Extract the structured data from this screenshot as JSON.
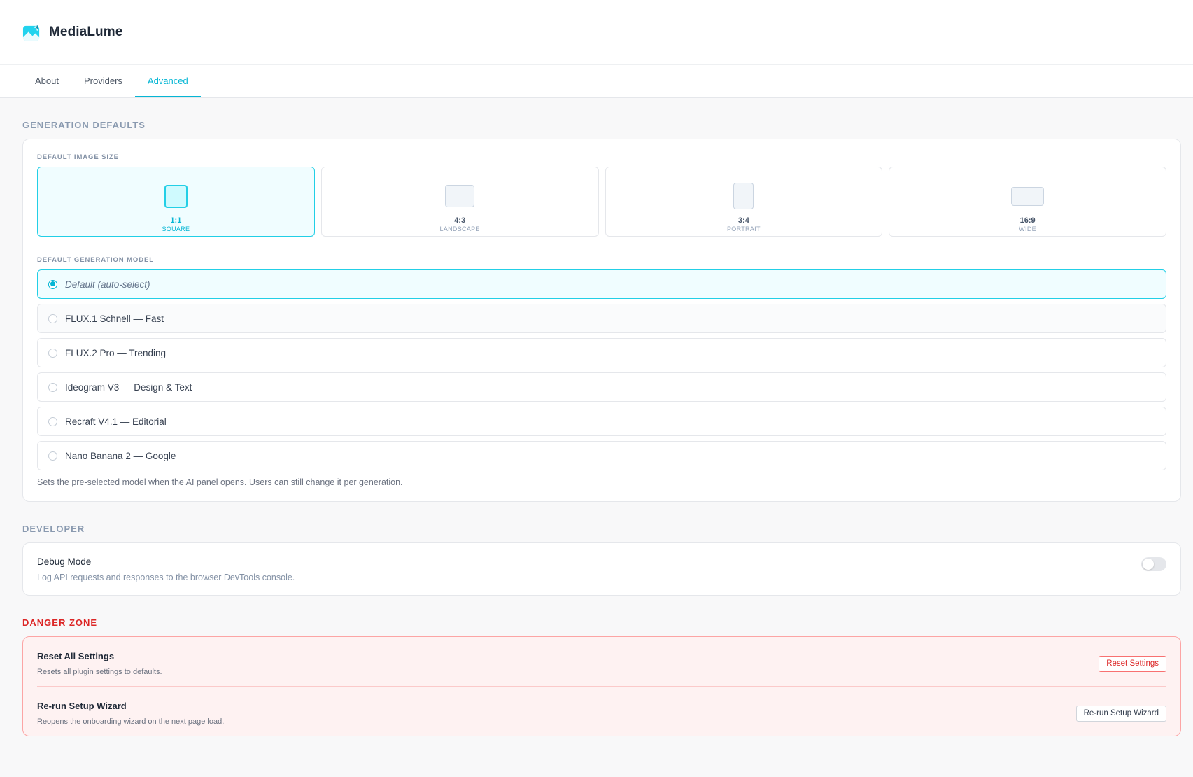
{
  "app": {
    "title": "MediaLume",
    "logo_icon": "sparkle-image-icon"
  },
  "tabs": [
    {
      "label": "About",
      "active": false
    },
    {
      "label": "Providers",
      "active": false
    },
    {
      "label": "Advanced",
      "active": true
    }
  ],
  "generation": {
    "section_title": "GENERATION DEFAULTS",
    "image_size_label": "DEFAULT IMAGE SIZE",
    "sizes": [
      {
        "ratio": "1:1",
        "name": "SQUARE",
        "selected": true
      },
      {
        "ratio": "4:3",
        "name": "LANDSCAPE",
        "selected": false
      },
      {
        "ratio": "3:4",
        "name": "PORTRAIT",
        "selected": false
      },
      {
        "ratio": "16:9",
        "name": "WIDE",
        "selected": false
      }
    ],
    "model_label": "DEFAULT GENERATION MODEL",
    "models": [
      {
        "label": "Default (auto-select)",
        "selected": true
      },
      {
        "label": "FLUX.1 Schnell — Fast",
        "selected": false
      },
      {
        "label": "FLUX.2 Pro — Trending",
        "selected": false
      },
      {
        "label": "Ideogram V3 — Design & Text",
        "selected": false
      },
      {
        "label": "Recraft V4.1 — Editorial",
        "selected": false
      },
      {
        "label": "Nano Banana 2 — Google",
        "selected": false
      }
    ],
    "help": "Sets the pre-selected model when the AI panel opens. Users can still change it per generation."
  },
  "developer": {
    "section_title": "DEVELOPER",
    "debug_title": "Debug Mode",
    "debug_desc": "Log API requests and responses to the browser DevTools console.",
    "debug_enabled": false
  },
  "danger": {
    "section_title": "DANGER ZONE",
    "reset_title": "Reset All Settings",
    "reset_desc": "Resets all plugin settings to defaults.",
    "reset_button": "Reset Settings",
    "wizard_title": "Re-run Setup Wizard",
    "wizard_desc": "Reopens the onboarding wizard on the next page load.",
    "wizard_button": "Re-run Setup Wizard"
  },
  "colors": {
    "accent": "#06b6d4",
    "danger": "#dc2626",
    "danger_bg": "#fef2f2"
  }
}
